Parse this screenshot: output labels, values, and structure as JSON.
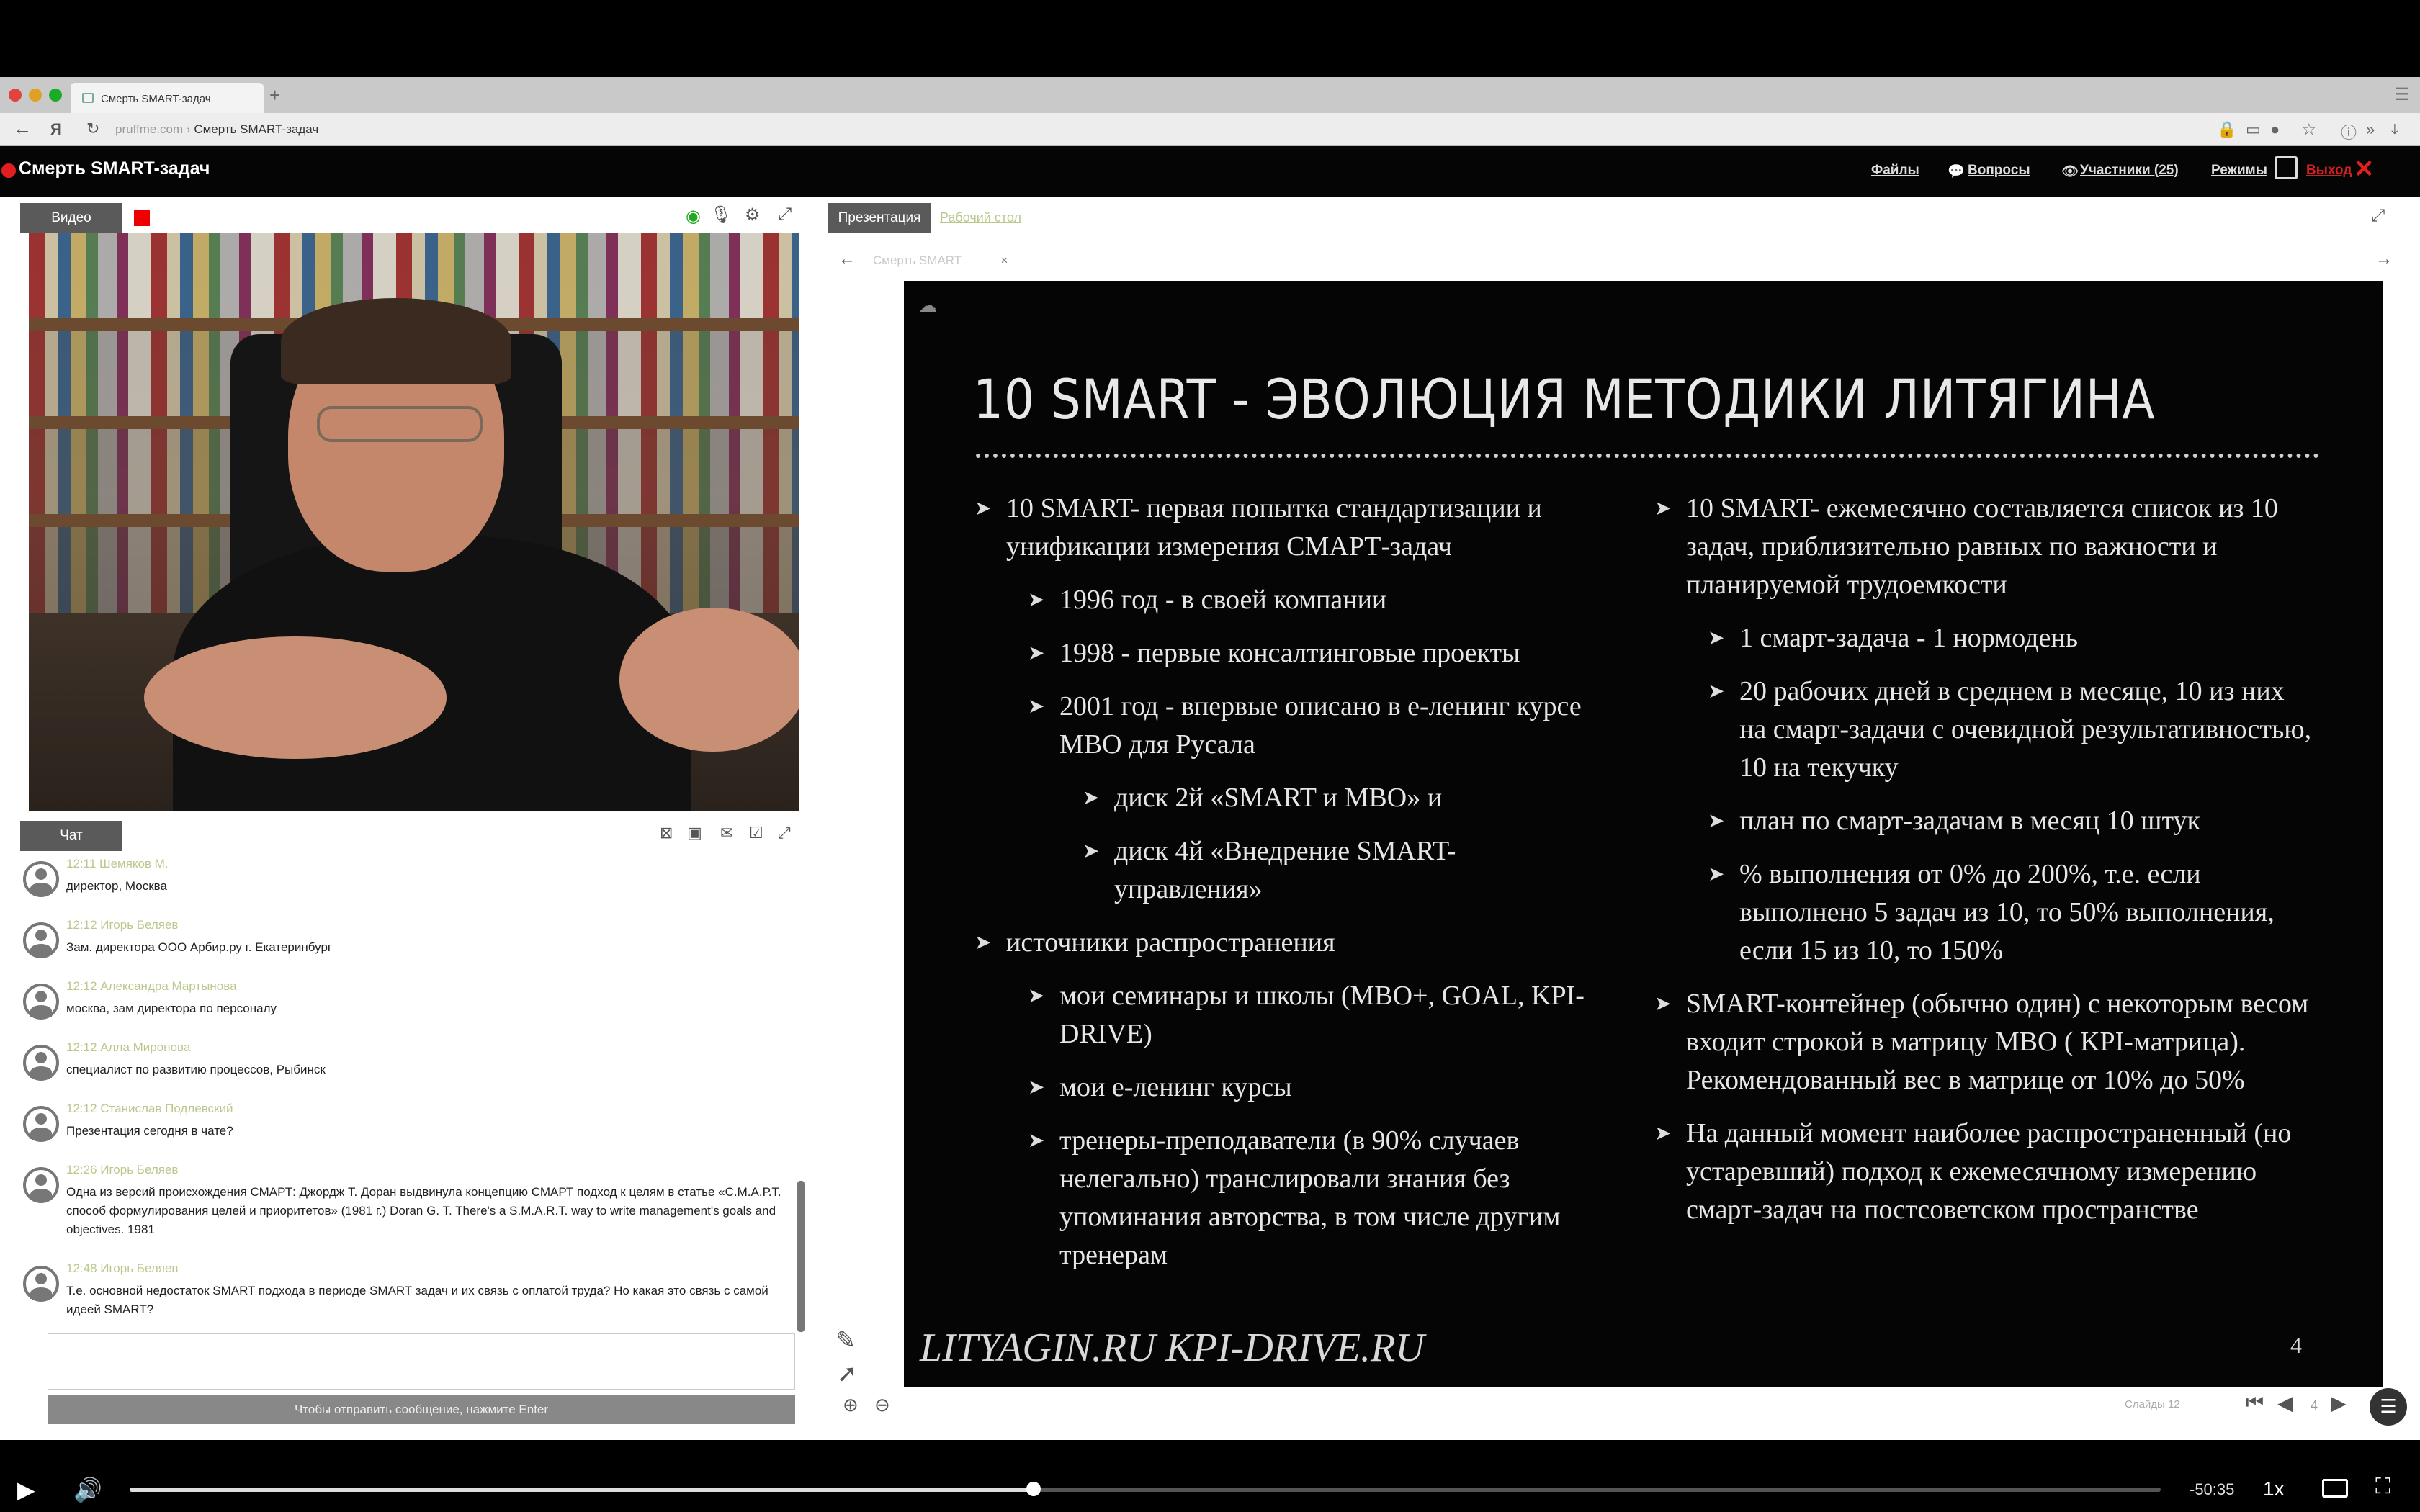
{
  "browser": {
    "tab_title": "Смерть SMART-задач",
    "new_tab": "+",
    "url_domain": "pruffme.com",
    "url_separator": "›",
    "url_title": "Смерть SMART-задач"
  },
  "app": {
    "title": "Смерть SMART-задач",
    "nav": {
      "files": "Файлы",
      "questions": "Вопросы",
      "participants": "Участники (25)",
      "modes": "Режимы",
      "exit": "Выход"
    }
  },
  "video_panel": {
    "tab_label": "Видео"
  },
  "chat": {
    "tab_label": "Чат",
    "send_hint": "Чтобы отправить сообщение, нажмите Enter",
    "messages": [
      {
        "meta": "12:11 Шемяков М.",
        "text": "директор, Москва"
      },
      {
        "meta": "12:12 Игорь Беляев",
        "text": "Зам. директора ООО Арбир.ру г. Екатеринбург"
      },
      {
        "meta": "12:12 Александра Мартынова",
        "text": "москва, зам директора по персоналу"
      },
      {
        "meta": "12:12 Алла Миронова",
        "text": "специалист по развитию процессов, Рыбинск"
      },
      {
        "meta": "12:12 Станислав Подлевский",
        "text": "Презентация сегодня в чате?"
      },
      {
        "meta": "12:26 Игорь Беляев",
        "text": "Одна из версий происхождения СМАРТ: Джордж Т. Доран выдвинула концепцию СМАРТ подход к целям в статье «С.М.А.Р.Т. способ формулирования целей и приоритетов» (1981 г.) Doran G. T. There's a S.M.A.R.T. way to write management's goals and objectives. 1981"
      },
      {
        "meta": "12:48 Игорь Беляев",
        "text": "Т.е. основной недостаток SMART подхода в периоде SMART задач и их связь с оплатой труда? Но какая это связь с самой идеей SMART?"
      }
    ]
  },
  "presentation": {
    "tab_presentation": "Презентация",
    "tab_desk": "Рабочий стол",
    "doc_tab": "Смерть SMART",
    "doc_close": "×",
    "pager": "Слайды 12",
    "page": "4"
  },
  "slide": {
    "title": "10 SMART - ЭВОЛЮЦИЯ МЕТОДИКИ ЛИТЯГИНА",
    "left": [
      {
        "level": 1,
        "text": "10 SMART- первая попытка стандартизации и унификации измерения СМАРТ-задач"
      },
      {
        "level": 2,
        "text": "1996 год - в своей компании"
      },
      {
        "level": 2,
        "text": "1998 - первые консалтинговые проекты"
      },
      {
        "level": 2,
        "text": "2001 год - впервые описано в е-ленинг курсе МВО для Русала"
      },
      {
        "level": 3,
        "text": "диск 2й «SMART и MBO» и"
      },
      {
        "level": 3,
        "text": "диск 4й «Внедрение SMART-управления»"
      },
      {
        "level": 1,
        "text": "источники распространения"
      },
      {
        "level": 2,
        "text": "мои семинары и школы (MBO+, GOAL, KPI-DRIVE)"
      },
      {
        "level": 2,
        "text": "мои е-ленинг курсы"
      },
      {
        "level": 2,
        "text": "тренеры-преподаватели (в 90% случаев нелегально) транслировали знания без упоминания авторства, в том числе другим тренерам"
      }
    ],
    "right": [
      {
        "level": 1,
        "text": "10 SMART- ежемесячно составляется список из 10 задач, приблизительно равных по важности и планируемой трудоемкости"
      },
      {
        "level": 2,
        "text": "1 смарт-задача - 1 нормодень"
      },
      {
        "level": 2,
        "text": "20 рабочих дней в среднем в месяце, 10 из них на смарт-задачи с очевидной результативностью, 10 на текучку"
      },
      {
        "level": 2,
        "text": "план по смарт-задачам в месяц 10 штук"
      },
      {
        "level": 2,
        "text": "% выполнения от 0% до 200%, т.е. если выполнено 5 задач из 10, то 50% выполнения, если 15 из 10, то 150%"
      },
      {
        "level": 1,
        "text": "SMART-контейнер (обычно один) с некоторым весом входит строкой в матрицу MBO ( KPI-матрица). Рекомендованный вес в матрице от 10% до 50%"
      },
      {
        "level": 1,
        "text": "На данный момент наиболее распространенный (но устаревший) подход к ежемесячному измерению смарт-задач на постсоветском пространстве"
      }
    ],
    "footer": "LITYAGIN.RU  KPI-DRIVE.RU",
    "number": "4"
  },
  "player": {
    "time_remaining": "-50:35",
    "speed": "1x",
    "progress": 0.445
  }
}
